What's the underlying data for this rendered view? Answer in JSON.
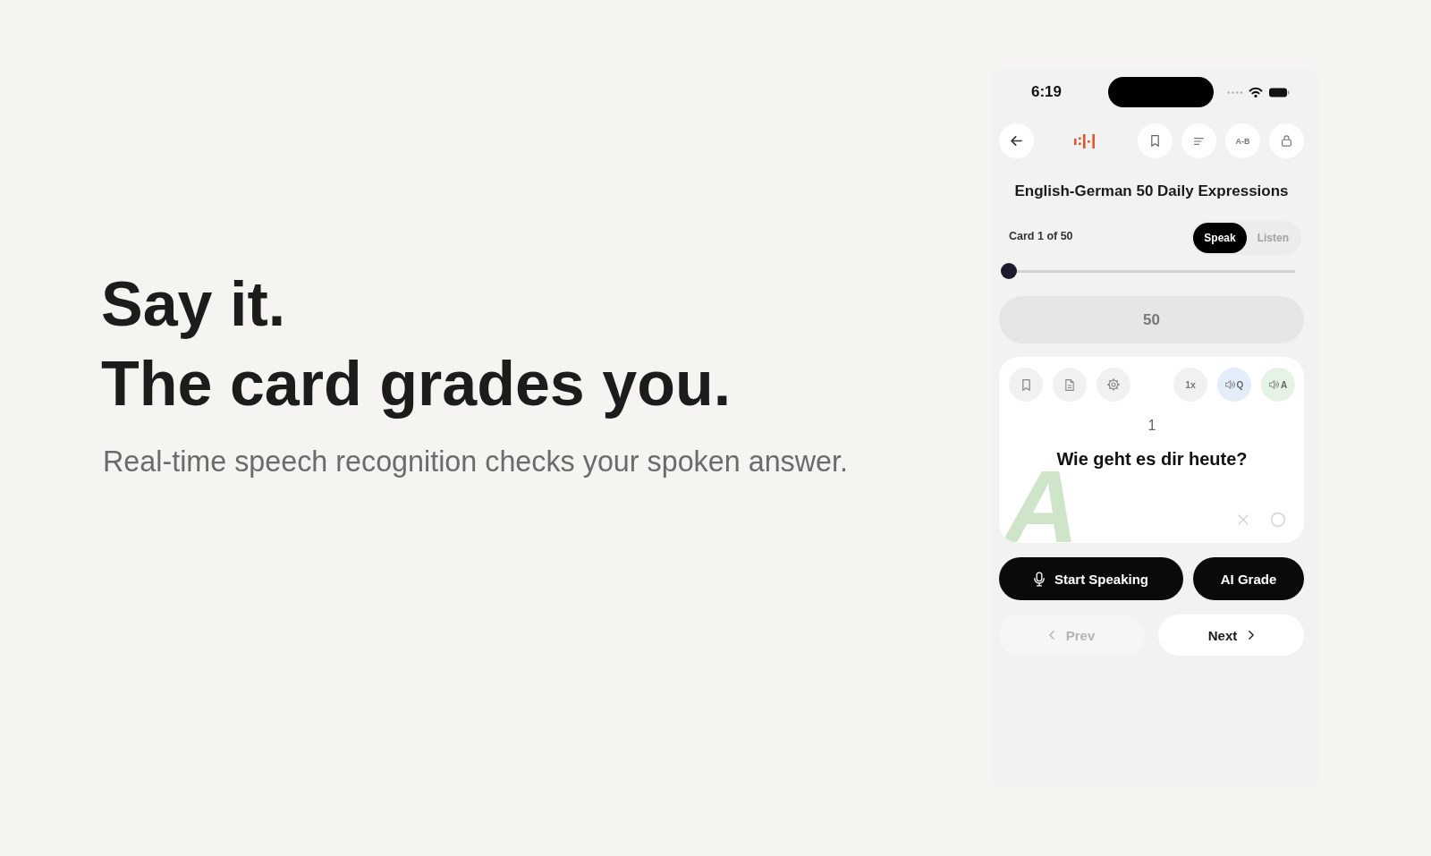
{
  "hero": {
    "headline": [
      "Say it.",
      "The card grades you."
    ],
    "subtitle": "Real-time speech recognition checks your spoken answer."
  },
  "phone": {
    "status_bar": {
      "time": "6:19"
    },
    "toolbar": {
      "compare_label": "A-B"
    },
    "deck_title": "English-German 50 Daily Expressions",
    "card_counter": "Card 1 of 50",
    "modes": [
      {
        "label": "Speak",
        "selected": true
      },
      {
        "label": "Listen",
        "selected": false
      }
    ],
    "progress": {
      "level": 0
    },
    "count": "50",
    "flashcard": {
      "speed": "1x",
      "audio_buttons": [
        {
          "label": "Q",
          "color": "#e3eefa"
        },
        {
          "label": "A",
          "color": "#e4f3e4"
        }
      ],
      "number": "1",
      "question": "Wie geht es dir heute?",
      "side_letter": "A"
    },
    "actions": {
      "speak": "Start Speaking",
      "grade": "AI Grade"
    },
    "pager": [
      {
        "kind": "prev",
        "label": "Prev",
        "disabled": true
      },
      {
        "kind": "next",
        "label": "Next",
        "disabled": false
      }
    ]
  }
}
